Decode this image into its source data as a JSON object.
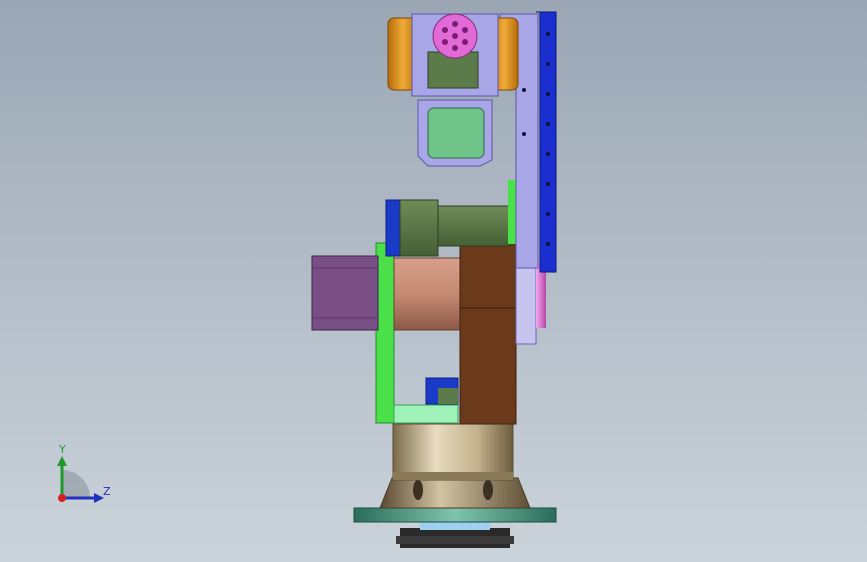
{
  "viewport": {
    "colors": {
      "bg_top": "#9aa6b4",
      "bg_bottom": "#cbd3da"
    }
  },
  "triad": {
    "axis_y_label": "Y",
    "axis_z_label": "Z",
    "colors": {
      "y": "#1f9a2a",
      "z": "#2233bb",
      "origin": "#d32020"
    }
  },
  "model": {
    "parts": [
      "base-plate",
      "base-turntable",
      "base-column",
      "lower-link-frame",
      "shoulder-motor",
      "shoulder-housing",
      "upper-arm-link",
      "elbow-motor",
      "wrist-housing",
      "end-effector-flange"
    ],
    "colors": {
      "arm_lavender": "#a9a6e8",
      "arm_blue": "#1b2ed0",
      "green_bright": "#49e04a",
      "green_dark": "#5b7c4a",
      "brown": "#6b3a1a",
      "copper": "#c58a72",
      "purple": "#7a4f86",
      "orange": "#e39a1e",
      "pink": "#e26ad7",
      "bronze": "#c9b98f",
      "teal": "#2f8a72"
    }
  }
}
